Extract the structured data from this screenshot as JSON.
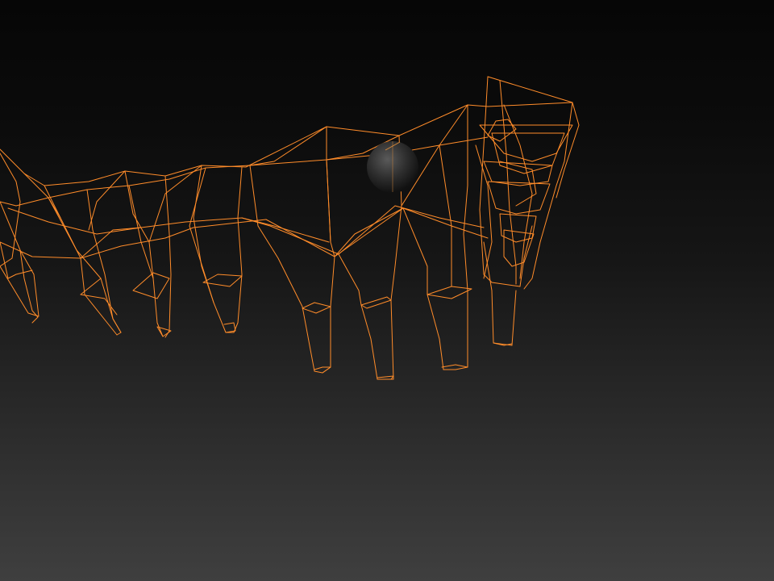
{
  "viewport": {
    "background": "dark-gradient"
  },
  "mesh": {
    "name": "wireframe-teeth-mesh",
    "wire_color": "#ff8c2a",
    "display_mode": "wireframe"
  },
  "gizmo": {
    "name": "sphere-gizmo",
    "color": "#3a3a3a"
  }
}
